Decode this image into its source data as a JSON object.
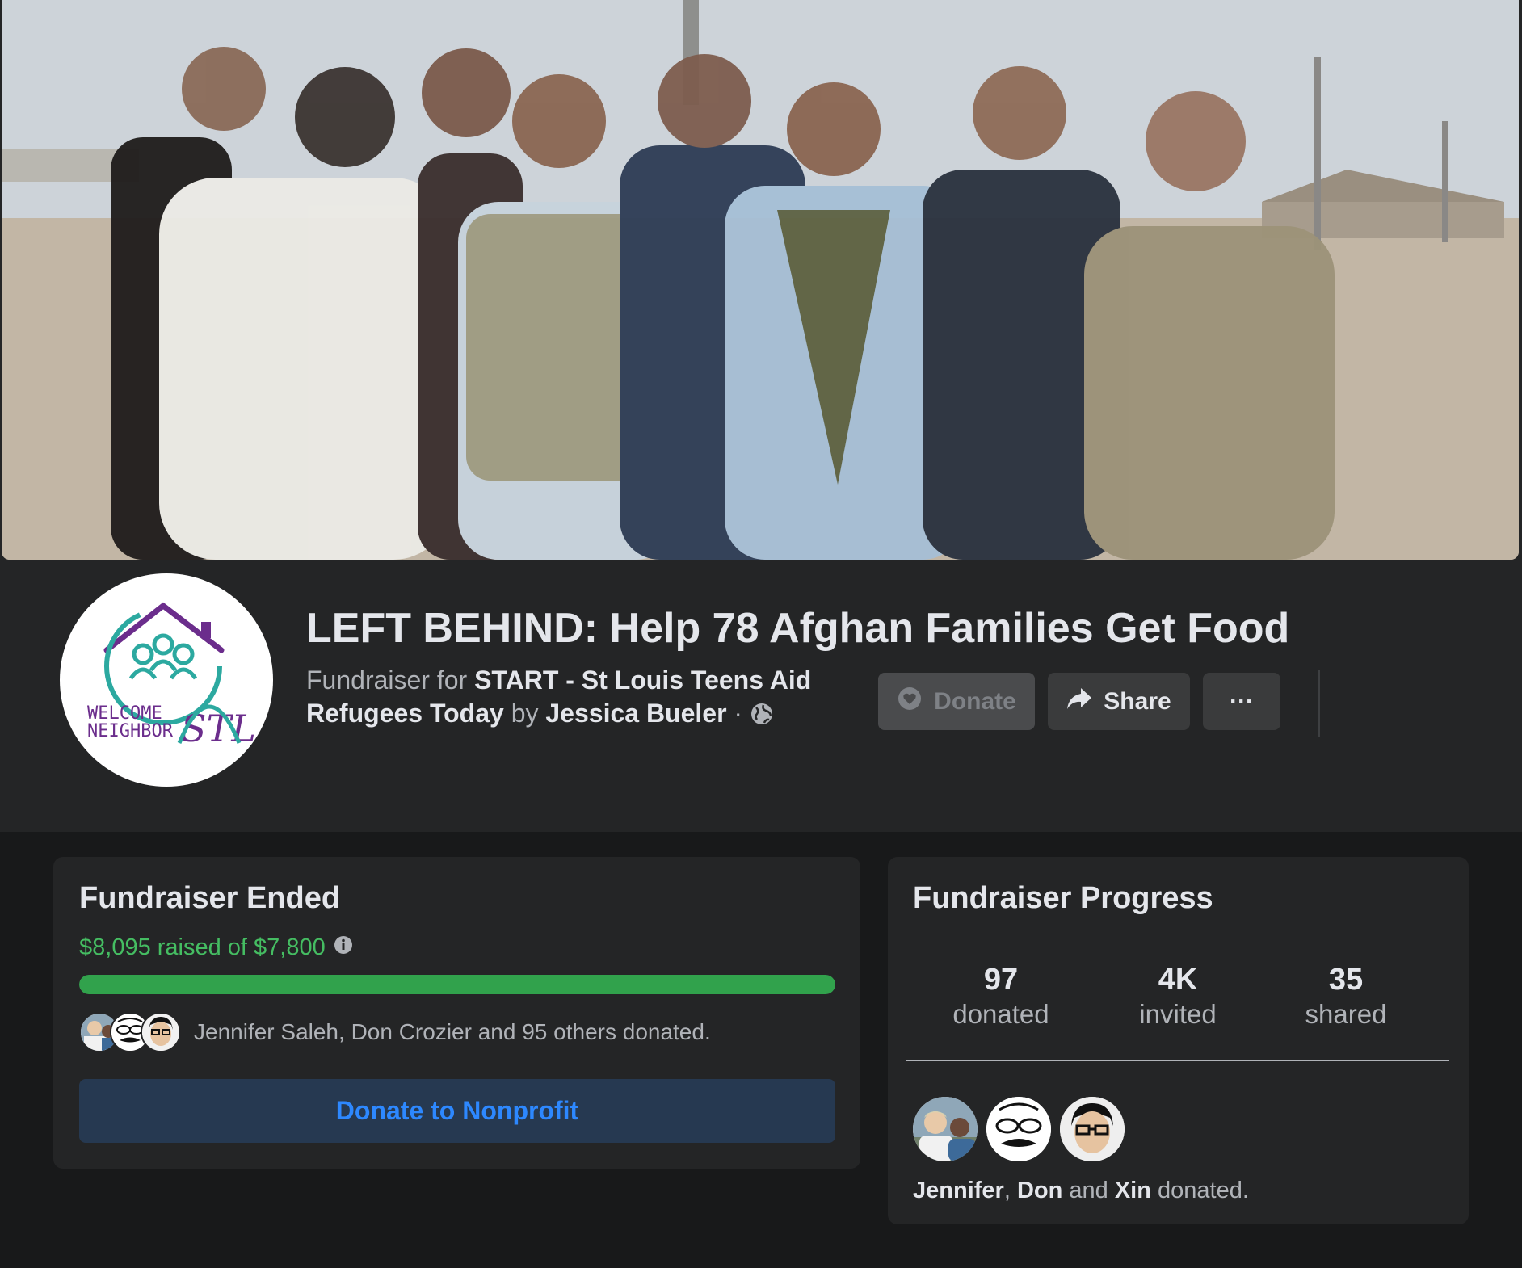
{
  "fundraiser": {
    "title": "LEFT BEHIND: Help 78 Afghan Families Get Food",
    "fundraiser_for_prefix": "Fundraiser for",
    "nonprofit_name": "START - St Louis Teens Aid Refugees Today",
    "by_word": "by",
    "organizer": "Jessica Bueler",
    "separator": "·",
    "audience_icon": "globe-icon",
    "logo_text": [
      "WELCOME",
      "NEIGHBOR",
      "STL"
    ]
  },
  "actions": {
    "donate_label": "Donate",
    "share_label": "Share",
    "more_label": "···"
  },
  "ended_card": {
    "title": "Fundraiser Ended",
    "raised_text": "$8,095 raised of $7,800",
    "raised_amount": 8095,
    "goal_amount": 7800,
    "progress_fraction": 1.0,
    "donors_text": "Jennifer Saleh, Don Crozier and 95 others donated.",
    "donate_button": "Donate to Nonprofit"
  },
  "progress_card": {
    "title": "Fundraiser Progress",
    "stats": [
      {
        "value": "97",
        "label": "donated"
      },
      {
        "value": "4K",
        "label": "invited"
      },
      {
        "value": "35",
        "label": "shared"
      }
    ],
    "recent_donors": [
      "Jennifer",
      "Don",
      "Xin"
    ],
    "comma": ",",
    "and_word": "and",
    "donated_suffix": "donated."
  },
  "colors": {
    "page_bg": "#18191a",
    "surface": "#242526",
    "accent_blue": "#2d88ff",
    "success_green": "#45bd62",
    "progress_green": "#31a24c"
  }
}
